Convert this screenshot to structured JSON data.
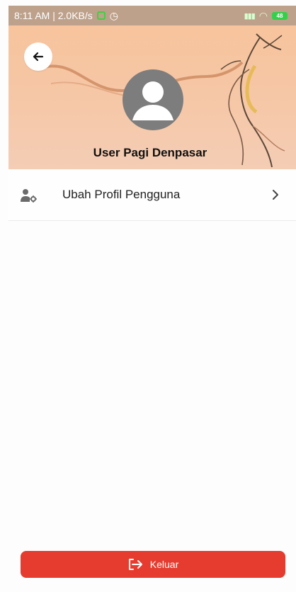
{
  "status_bar": {
    "time_and_speed": "8:11 AM | 2.0KB/s",
    "battery_level": "48"
  },
  "header": {
    "user_name": "User Pagi Denpasar"
  },
  "menu": {
    "items": [
      {
        "label": "Ubah Profil Pengguna",
        "icon": "user-settings-icon"
      }
    ]
  },
  "footer": {
    "logout_label": "Keluar"
  },
  "colors": {
    "hero_background": "#f7c39a",
    "logout_button": "#e53c2f",
    "avatar": "#7d7d7d"
  }
}
